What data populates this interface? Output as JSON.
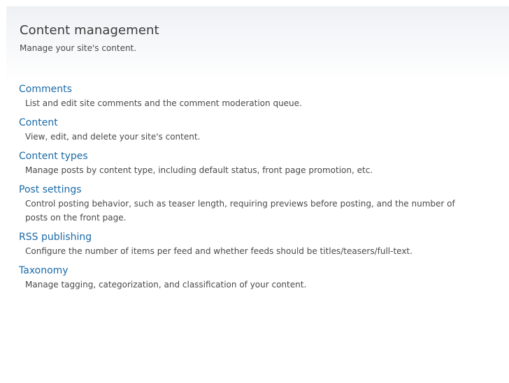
{
  "section": {
    "title": "Content management",
    "description": "Manage your site's content."
  },
  "items": [
    {
      "label": "Comments",
      "description": "List and edit site comments and the comment moderation queue."
    },
    {
      "label": "Content",
      "description": "View, edit, and delete your site's content."
    },
    {
      "label": "Content types",
      "description": "Manage posts by content type, including default status, front page promotion, etc."
    },
    {
      "label": "Post settings",
      "description": "Control posting behavior, such as teaser length, requiring previews before posting, and the number of posts on the front page."
    },
    {
      "label": "RSS publishing",
      "description": "Configure the number of items per feed and whether feeds should be titles/teasers/full-text."
    },
    {
      "label": "Taxonomy",
      "description": "Manage tagging, categorization, and classification of your content."
    }
  ]
}
